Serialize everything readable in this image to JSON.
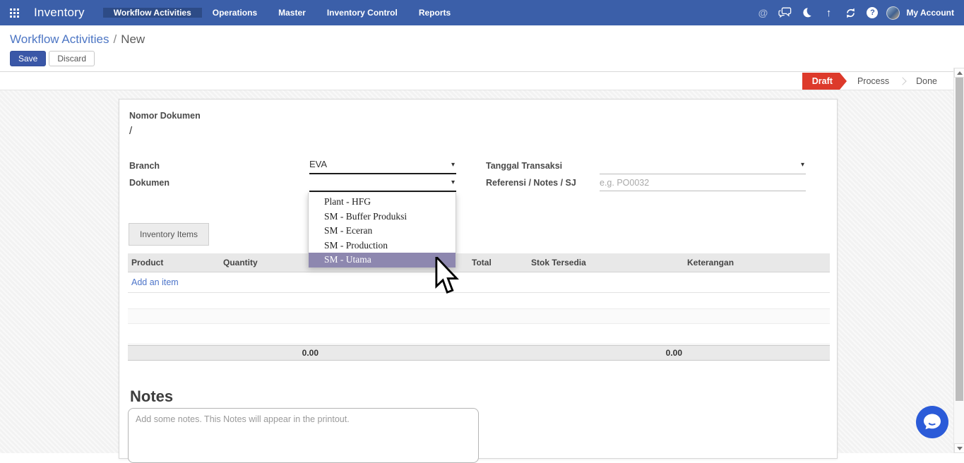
{
  "app": {
    "name": "Inventory",
    "menu": [
      "Workflow Activities",
      "Operations",
      "Master",
      "Inventory Control",
      "Reports"
    ],
    "active_menu": "Workflow Activities",
    "account_label": "My Account"
  },
  "icons": {
    "at": "@",
    "arrow_up": "↑",
    "help": "?",
    "caret_down": "▾"
  },
  "breadcrumb": {
    "parent": "Workflow Activities",
    "separator": "/",
    "current": "New"
  },
  "actions": {
    "save": "Save",
    "discard": "Discard"
  },
  "statusbar": {
    "states": [
      "Draft",
      "Process",
      "Done"
    ],
    "active": "Draft"
  },
  "form": {
    "nomor_dokumen": {
      "label": "Nomor Dokumen",
      "value": "/"
    },
    "branch": {
      "label": "Branch",
      "value": "EVA"
    },
    "dokumen": {
      "label": "Dokumen",
      "value": ""
    },
    "tanggal": {
      "label": "Tanggal Transaksi",
      "value": ""
    },
    "referensi": {
      "label": "Referensi / Notes / SJ",
      "value": "",
      "placeholder": "e.g. PO0032"
    }
  },
  "dokumen_dropdown": {
    "options": [
      "Plant - HFG",
      "SM - Buffer Produksi",
      "SM - Eceran",
      "SM - Production",
      "SM - Utama"
    ],
    "highlighted": "SM - Utama"
  },
  "tabs": [
    {
      "label": "Inventory Items",
      "active": true
    }
  ],
  "table": {
    "headers": [
      "Product",
      "Quantity",
      "Total",
      "Stok Tersedia",
      "Keterangan"
    ],
    "add_row_label": "Add an item",
    "rows": [],
    "footer": {
      "quantity_total": "0.00",
      "stok_total": "0.00"
    }
  },
  "notes": {
    "heading": "Notes",
    "placeholder": "Add some notes. This Notes will appear in the printout."
  },
  "colors": {
    "navbar": "#3b5fa9",
    "navbar_active": "#2d4b86",
    "status_active": "#dd3a2b",
    "dropdown_highlight": "#8d87af",
    "link": "#4c74c9",
    "chat_fab": "#2b5bd8"
  }
}
